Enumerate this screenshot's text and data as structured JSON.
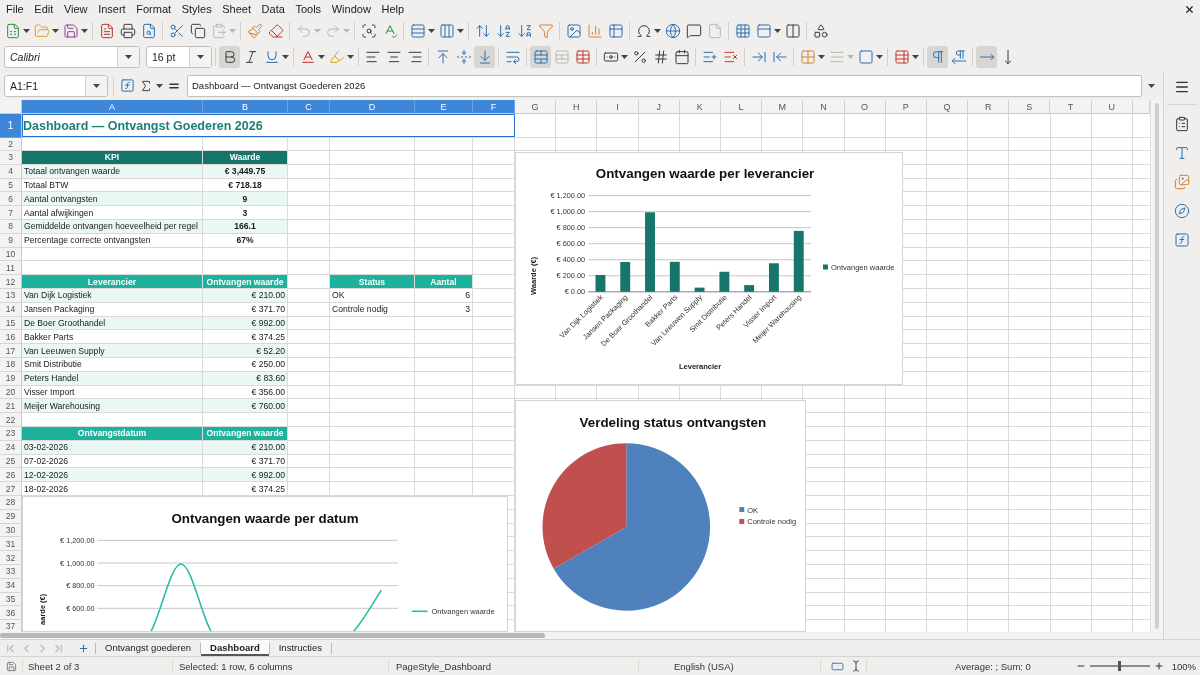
{
  "menu": [
    "File",
    "Edit",
    "View",
    "Insert",
    "Format",
    "Styles",
    "Sheet",
    "Data",
    "Tools",
    "Window",
    "Help"
  ],
  "standard_toolbar": {
    "groups": [
      [
        {
          "kind": "new",
          "disabled": false
        },
        {
          "kind": "open",
          "disabled": false
        },
        {
          "kind": "save",
          "disabled": false
        }
      ],
      [
        {
          "kind": "pdf",
          "disabled": false
        },
        {
          "kind": "print",
          "disabled": false
        },
        {
          "kind": "preview",
          "disabled": false
        }
      ],
      [
        {
          "kind": "cut",
          "disabled": false
        },
        {
          "kind": "copy",
          "disabled": false
        },
        {
          "kind": "paste",
          "disabled": true
        }
      ],
      [
        {
          "kind": "clone",
          "disabled": false
        },
        {
          "kind": "clear",
          "disabled": false
        }
      ],
      [
        {
          "kind": "undo",
          "disabled": true
        },
        {
          "kind": "redo",
          "disabled": true
        }
      ],
      [
        {
          "kind": "find",
          "disabled": false
        },
        {
          "kind": "spelling",
          "disabled": false
        }
      ],
      [
        {
          "kind": "row",
          "disabled": false
        },
        {
          "kind": "column",
          "disabled": false
        }
      ],
      [
        {
          "kind": "sort",
          "disabled": false
        },
        {
          "kind": "ascending",
          "disabled": false
        },
        {
          "kind": "descending",
          "disabled": false
        },
        {
          "kind": "filter",
          "disabled": false
        }
      ],
      [
        {
          "kind": "image",
          "disabled": false
        },
        {
          "kind": "chart",
          "disabled": false
        },
        {
          "kind": "pivot",
          "disabled": false
        }
      ],
      [
        {
          "kind": "symbol",
          "disabled": false
        },
        {
          "kind": "hyperlink",
          "disabled": false
        },
        {
          "kind": "comment",
          "disabled": false
        },
        {
          "kind": "headerfooter",
          "disabled": true
        }
      ],
      [
        {
          "kind": "printarea",
          "disabled": false
        },
        {
          "kind": "freeze",
          "disabled": false
        },
        {
          "kind": "split",
          "disabled": false
        }
      ],
      [
        {
          "kind": "shapes",
          "disabled": false
        }
      ]
    ]
  },
  "formatting_toolbar": {
    "font_name": "Calibri",
    "font_size": "16 pt",
    "groups": [
      [
        {
          "kind": "bold",
          "pressed": true,
          "disabled": false
        },
        {
          "kind": "italic",
          "pressed": false,
          "disabled": false
        },
        {
          "kind": "underline",
          "pressed": false,
          "disabled": false
        }
      ],
      [
        {
          "kind": "fontcolor",
          "pressed": false,
          "disabled": false
        },
        {
          "kind": "highlight",
          "pressed": false,
          "disabled": false
        }
      ],
      [
        {
          "kind": "left",
          "pressed": false,
          "disabled": false
        },
        {
          "kind": "center",
          "pressed": false,
          "disabled": false
        },
        {
          "kind": "right",
          "pressed": false,
          "disabled": false
        }
      ],
      [
        {
          "kind": "top",
          "pressed": false,
          "disabled": false
        },
        {
          "kind": "middle",
          "pressed": false,
          "disabled": false
        },
        {
          "kind": "bottom",
          "pressed": true,
          "disabled": false
        }
      ],
      [
        {
          "kind": "wrap",
          "pressed": false,
          "disabled": false
        }
      ],
      [
        {
          "kind": "mergecenter",
          "pressed": true,
          "disabled": false
        },
        {
          "kind": "unmerge",
          "pressed": false,
          "disabled": true
        },
        {
          "kind": "merge",
          "pressed": false,
          "disabled": false
        }
      ],
      [
        {
          "kind": "currency",
          "pressed": false,
          "disabled": false
        },
        {
          "kind": "percent",
          "pressed": false,
          "disabled": false
        },
        {
          "kind": "number",
          "pressed": false,
          "disabled": false
        },
        {
          "kind": "date",
          "pressed": false,
          "disabled": false
        }
      ],
      [
        {
          "kind": "adddecimal",
          "pressed": false,
          "disabled": false
        },
        {
          "kind": "deletedecimal",
          "pressed": false,
          "disabled": false
        }
      ],
      [
        {
          "kind": "indent",
          "pressed": false,
          "disabled": false
        },
        {
          "kind": "outdent",
          "pressed": false,
          "disabled": false
        }
      ],
      [
        {
          "kind": "borders",
          "pressed": false,
          "disabled": false
        },
        {
          "kind": "borderstyle",
          "pressed": false,
          "disabled": true
        },
        {
          "kind": "bordercolor",
          "pressed": false,
          "disabled": false
        }
      ],
      [
        {
          "kind": "conditional",
          "pressed": false,
          "disabled": false
        }
      ],
      [
        {
          "kind": "ltr",
          "pressed": true,
          "disabled": false
        },
        {
          "kind": "rtl",
          "pressed": false,
          "disabled": false
        }
      ],
      [
        {
          "kind": "horizontal",
          "pressed": true,
          "disabled": false
        },
        {
          "kind": "vertical",
          "pressed": false,
          "disabled": false
        }
      ]
    ]
  },
  "formula_bar": {
    "name_box": "A1:F1",
    "content": "Dashboard — Ontvangst Goederen 2026"
  },
  "sheet": {
    "columns": [
      {
        "label": "A",
        "selected": true
      },
      {
        "label": "B",
        "selected": true
      },
      {
        "label": "C",
        "selected": true
      },
      {
        "label": "D",
        "selected": true
      },
      {
        "label": "E",
        "selected": true
      },
      {
        "label": "F",
        "selected": true
      },
      {
        "label": "G",
        "selected": false
      },
      {
        "label": "H",
        "selected": false
      },
      {
        "label": "I",
        "selected": false
      },
      {
        "label": "J",
        "selected": false
      },
      {
        "label": "K",
        "selected": false
      },
      {
        "label": "L",
        "selected": false
      },
      {
        "label": "M",
        "selected": false
      },
      {
        "label": "N",
        "selected": false
      },
      {
        "label": "O",
        "selected": false
      },
      {
        "label": "P",
        "selected": false
      },
      {
        "label": "Q",
        "selected": false
      },
      {
        "label": "R",
        "selected": false
      },
      {
        "label": "S",
        "selected": false
      },
      {
        "label": "T",
        "selected": false
      },
      {
        "label": "U",
        "selected": false
      }
    ],
    "rows": [
      {
        "label": "1",
        "selected": true
      },
      {
        "label": "2",
        "selected": false
      },
      {
        "label": "3",
        "selected": false
      },
      {
        "label": "4",
        "selected": false
      },
      {
        "label": "5",
        "selected": false
      },
      {
        "label": "6",
        "selected": false
      },
      {
        "label": "7",
        "selected": false
      },
      {
        "label": "8",
        "selected": false
      },
      {
        "label": "9",
        "selected": false
      },
      {
        "label": "10",
        "selected": false
      },
      {
        "label": "11",
        "selected": false
      },
      {
        "label": "12",
        "selected": false
      },
      {
        "label": "13",
        "selected": false
      },
      {
        "label": "14",
        "selected": false
      },
      {
        "label": "15",
        "selected": false
      },
      {
        "label": "16",
        "selected": false
      },
      {
        "label": "17",
        "selected": false
      },
      {
        "label": "18",
        "selected": false
      },
      {
        "label": "19",
        "selected": false
      },
      {
        "label": "20",
        "selected": false
      },
      {
        "label": "21",
        "selected": false
      },
      {
        "label": "22",
        "selected": false
      },
      {
        "label": "23",
        "selected": false
      },
      {
        "label": "24",
        "selected": false
      },
      {
        "label": "25",
        "selected": false
      },
      {
        "label": "26",
        "selected": false
      },
      {
        "label": "27",
        "selected": false
      },
      {
        "label": "28",
        "selected": false
      },
      {
        "label": "29",
        "selected": false
      },
      {
        "label": "30",
        "selected": false
      },
      {
        "label": "31",
        "selected": false
      },
      {
        "label": "32",
        "selected": false
      },
      {
        "label": "33",
        "selected": false
      },
      {
        "label": "34",
        "selected": false
      },
      {
        "label": "35",
        "selected": false
      },
      {
        "label": "36",
        "selected": false
      },
      {
        "label": "37",
        "selected": false
      }
    ],
    "title": "Dashboard — Ontvangst Goederen 2026",
    "kpi_table": {
      "columns": [
        "KPI",
        "Waarde"
      ],
      "rows": [
        [
          "Totaal ontvangen waarde",
          "€ 3,449.75"
        ],
        [
          "Totaal BTW",
          "€ 718.18"
        ],
        [
          "Aantal ontvangsten",
          "9"
        ],
        [
          "Aantal afwijkingen",
          "3"
        ],
        [
          "Gemiddelde ontvangen hoeveelheid per regel",
          "166.1"
        ],
        [
          "Percentage correcte ontvangsten",
          "67%"
        ]
      ]
    },
    "supplier_table": {
      "columns": [
        "Leverancier",
        "Ontvangen waarde"
      ],
      "rows": [
        [
          "Van Dijk Logistiek",
          "€ 210.00"
        ],
        [
          "Jansen Packaging",
          "€ 371.70"
        ],
        [
          "De Boer Groothandel",
          "€ 992.00"
        ],
        [
          "Bakker Parts",
          "€ 374.25"
        ],
        [
          "Van Leeuwen Supply",
          "€ 52.20"
        ],
        [
          "Smit Distributie",
          "€ 250.00"
        ],
        [
          "Peters Handel",
          "€ 83.60"
        ],
        [
          "Visser Import",
          "€ 356.00"
        ],
        [
          "Meijer Warehousing",
          "€ 760.00"
        ]
      ]
    },
    "status_table": {
      "columns": [
        "Status",
        "Aantal"
      ],
      "rows": [
        [
          "OK",
          "6"
        ],
        [
          "Controle nodig",
          "3"
        ]
      ]
    },
    "date_table": {
      "columns": [
        "Ontvangstdatum",
        "Ontvangen waarde"
      ],
      "rows": [
        [
          "03-02-2026",
          "€ 210.00"
        ],
        [
          "07-02-2026",
          "€ 371.70"
        ],
        [
          "12-02-2026",
          "€ 992.00"
        ],
        [
          "18-02-2026",
          "€ 374.25"
        ]
      ]
    }
  },
  "charts": [
    {
      "chart_data": {
        "type": "bar",
        "title": "Ontvangen waarde per leverancier",
        "xlabel": "Leverancier",
        "ylabel": "Waarde (€)",
        "categories": [
          "Van Dijk Logistiek",
          "Jansen Packaging",
          "De Boer Groothandel",
          "Bakker Parts",
          "Van Leeuwen Supply",
          "Smit Distributie",
          "Peters Handel",
          "Visser Import",
          "Meijer Warehousing"
        ],
        "series": [
          {
            "name": "Ontvangen waarde",
            "color": "#17766b",
            "values": [
              210,
              371.7,
              992,
              374.25,
              52.2,
              250,
              83.6,
              356,
              760
            ]
          }
        ],
        "ylim": [
          0,
          1200
        ],
        "yticks": [
          {
            "value": 0,
            "label": "€ 0.00"
          },
          {
            "value": 200,
            "label": "€ 200.00"
          },
          {
            "value": 400,
            "label": "€ 400.00"
          },
          {
            "value": 600,
            "label": "€ 600.00"
          },
          {
            "value": 800,
            "label": "€ 800.00"
          },
          {
            "value": 1000,
            "label": "€ 1,000.00"
          },
          {
            "value": 1200,
            "label": "€ 1,200.00"
          }
        ],
        "grid": true,
        "legend": "right"
      }
    },
    {
      "chart_data": {
        "type": "pie",
        "title": "Verdeling status ontvangsten",
        "categories": [
          "OK",
          "Controle nodig"
        ],
        "values": [
          66.7,
          33.3
        ],
        "colors": [
          "#4f81bd",
          "#c0504d"
        ],
        "legend": "right"
      }
    },
    {
      "chart_data": {
        "type": "line",
        "title": "Ontvangen waarde per datum",
        "ylabel": "aarde (€)",
        "series": [
          {
            "name": "Ontvangen waarde",
            "color": "#2bbba6",
            "values": [
              null,
              null,
              992,
              null,
              null,
              null,
              null,
              null,
              760
            ]
          }
        ],
        "ylim": [
          400,
          1200
        ],
        "yticks": [
          {
            "value": 600,
            "label": "€ 600.00"
          },
          {
            "value": 800,
            "label": "€ 800.00"
          },
          {
            "value": 1000,
            "label": "€ 1,000.00"
          },
          {
            "value": 1200,
            "label": "€ 1,200.00"
          }
        ],
        "grid": true,
        "legend": "right"
      }
    }
  ],
  "sheet_tabs": [
    {
      "label": "Ontvangst goederen",
      "selected": false
    },
    {
      "label": "Dashboard",
      "selected": true
    },
    {
      "label": "Instructies",
      "selected": false
    }
  ],
  "status_bar": {
    "sheet": "Sheet 2 of 3",
    "selection": "Selected: 1 row, 6 columns",
    "page_style": "PageStyle_Dashboard",
    "language": "English (USA)",
    "summary": "Average: ; Sum: 0",
    "zoom_slider": {
      "level": 0.5
    },
    "zoom": "100%"
  }
}
